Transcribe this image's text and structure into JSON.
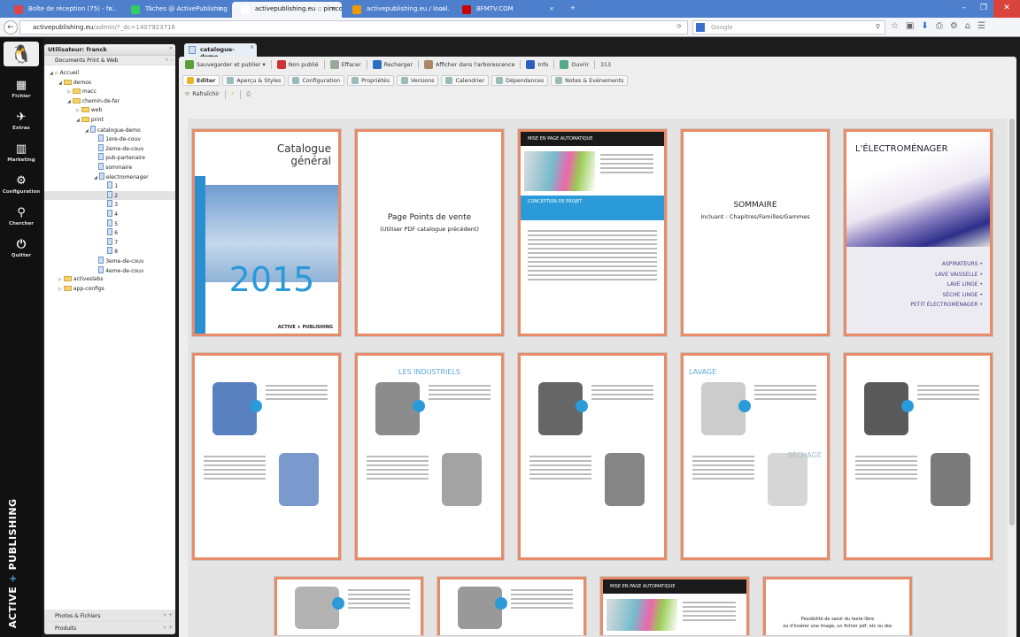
{
  "browser": {
    "tabs": [
      {
        "label": "Boîte de réception (75) - fr...",
        "color": "#d44"
      },
      {
        "label": "Tâches @ ActivePublishing",
        "color": "#3c6"
      },
      {
        "label": "activepublishing.eu :: pimcore",
        "color": "#fff",
        "active": true
      },
      {
        "label": "activepublishing.eu / local...",
        "color": "#e90"
      },
      {
        "label": "BFMTV.COM",
        "color": "#c00"
      }
    ],
    "new_tab": "+",
    "url_host": "activepublishing.eu",
    "url_path": "/admin/?_dc=1407923716",
    "search_placeholder": "Google"
  },
  "iconbar": {
    "items": [
      {
        "label": "Fichier",
        "icon": "▦"
      },
      {
        "label": "Extras",
        "icon": "✈"
      },
      {
        "label": "Marketing",
        "icon": "▥"
      },
      {
        "label": "Configuration",
        "icon": "⚙"
      },
      {
        "label": "Chercher",
        "icon": "⚲"
      },
      {
        "label": "Quitter",
        "icon": "⏻"
      }
    ],
    "brand_a": "ACTIVE",
    "brand_plus": "+",
    "brand_b": "PUBLISHING"
  },
  "tree": {
    "user": "Utilisateur: franck",
    "section": "Documents Print & Web",
    "nodes": [
      {
        "label": "Accueil",
        "d": 0,
        "t": "home",
        "a": "◢"
      },
      {
        "label": "demos",
        "d": 1,
        "t": "fo",
        "a": "◢"
      },
      {
        "label": "macc",
        "d": 2,
        "t": "fo",
        "a": "▷"
      },
      {
        "label": "chemin-de-fer",
        "d": 2,
        "t": "fo",
        "a": "◢"
      },
      {
        "label": "web",
        "d": 3,
        "t": "fo",
        "a": "▷"
      },
      {
        "label": "print",
        "d": 3,
        "t": "fo",
        "a": "◢"
      },
      {
        "label": "catalogue-demo",
        "d": 4,
        "t": "dc",
        "a": "◢"
      },
      {
        "label": "1ere-de-couv",
        "d": 5,
        "t": "dc",
        "a": ""
      },
      {
        "label": "2eme-de-couv",
        "d": 5,
        "t": "dc",
        "a": ""
      },
      {
        "label": "pub-partenaire",
        "d": 5,
        "t": "dc",
        "a": ""
      },
      {
        "label": "sommaire",
        "d": 5,
        "t": "dc",
        "a": ""
      },
      {
        "label": "electromenager",
        "d": 5,
        "t": "dc",
        "a": "◢"
      },
      {
        "label": "1",
        "d": 6,
        "t": "dc",
        "a": ""
      },
      {
        "label": "2",
        "d": 6,
        "t": "dc",
        "a": "",
        "sel": true
      },
      {
        "label": "3",
        "d": 6,
        "t": "dc",
        "a": ""
      },
      {
        "label": "4",
        "d": 6,
        "t": "dc",
        "a": ""
      },
      {
        "label": "5",
        "d": 6,
        "t": "dc",
        "a": ""
      },
      {
        "label": "6",
        "d": 6,
        "t": "dc",
        "a": ""
      },
      {
        "label": "7",
        "d": 6,
        "t": "dc",
        "a": ""
      },
      {
        "label": "8",
        "d": 6,
        "t": "dc",
        "a": ""
      },
      {
        "label": "3eme-de-couv",
        "d": 5,
        "t": "dc",
        "a": ""
      },
      {
        "label": "4eme-de-couv",
        "d": 5,
        "t": "dc",
        "a": ""
      },
      {
        "label": "activeslabs",
        "d": 1,
        "t": "fo",
        "a": "▷"
      },
      {
        "label": "app-configs",
        "d": 1,
        "t": "fo",
        "a": "▷"
      }
    ],
    "bottom_panels": [
      "Photos & Fichiers",
      "Produits"
    ]
  },
  "editor": {
    "doc_tab": "catalogue-demo",
    "toolbar": [
      {
        "label": "Sauvegarder et publier ▾",
        "color": "#5a9e3a"
      },
      {
        "label": "Non publié",
        "color": "#c33"
      },
      {
        "label": "Effacer",
        "color": "#9a9"
      },
      {
        "label": "Recharger",
        "color": "#2a6fc0"
      },
      {
        "label": "Afficher dans l'arborescence",
        "color": "#a86"
      },
      {
        "label": "Info",
        "color": "#2a5fc0"
      },
      {
        "label": "Ouvrir",
        "color": "#5a8"
      }
    ],
    "doc_id": "313",
    "subtabs": [
      "Editer",
      "Aperçu & Styles",
      "Configuration",
      "Propriétés",
      "Versions",
      "Calendrier",
      "Dépendances",
      "Notes & Evénements"
    ],
    "refresh": "Rafraîchir"
  },
  "pages": [
    {
      "kind": "cover",
      "title": "Catalogue général",
      "year": "2015",
      "footer": "ACTIVE + PUBLISHING"
    },
    {
      "kind": "text",
      "title": "Page Points de vente",
      "sub": "(Utiliser PDF catalogue précédent)"
    },
    {
      "kind": "mise",
      "title": "MISE EN PAGE AUTOMATIQUE",
      "band": "CONCEPTION DE PROJET"
    },
    {
      "kind": "text",
      "title": "SOMMAIRE",
      "sub": "Incluant : Chapitres/Familles/Gammes"
    },
    {
      "kind": "elec",
      "title": "L'ÉLECTROMÉNAGER",
      "items": [
        "ASPIRATEURS •",
        "LAVE VAISSELLE •",
        "LAVE LINGE •",
        "SÈCHE LINGE •",
        "PETIT ÉLECTROMÉNAGER •"
      ]
    },
    {
      "kind": "prod",
      "title": "",
      "color": "#2255aa"
    },
    {
      "kind": "prod",
      "title": "LES INDUSTRIELS",
      "color": "#666"
    },
    {
      "kind": "prod",
      "title": "",
      "color": "#333"
    },
    {
      "kind": "prod",
      "title": "LAVAGE",
      "title2": "SÉCHAGE",
      "color": "#bbb"
    },
    {
      "kind": "prod",
      "title": "",
      "color": "#222"
    },
    {
      "kind": "prod",
      "title": "",
      "color": "#999"
    },
    {
      "kind": "prod",
      "title": "",
      "color": "#777"
    },
    {
      "kind": "mise",
      "title": "MISE EN PAGE AUTOMATIQUE",
      "band": ""
    },
    {
      "kind": "text2",
      "title": "Possibilité de saisir du texte libre",
      "sub": "ou d'insérer une image, un fichier pdf, etc ou doc"
    }
  ]
}
